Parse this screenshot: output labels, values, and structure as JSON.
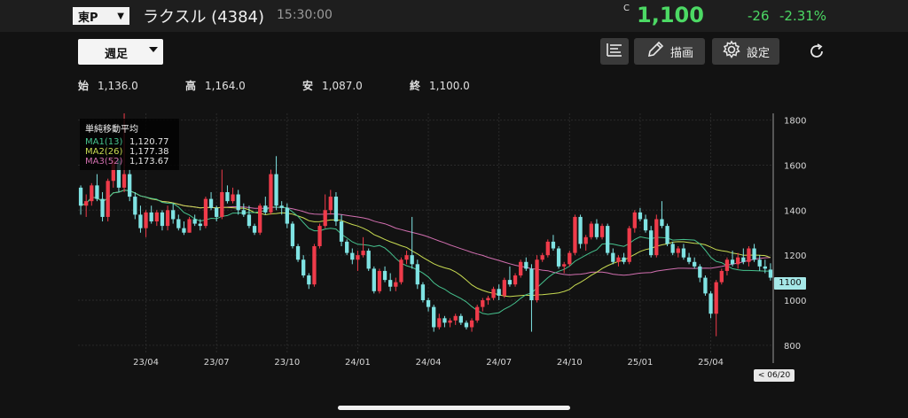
{
  "header": {
    "market": "東P",
    "name": "ラクスル (4384)",
    "time": "15:30:00",
    "price_flag": "C",
    "price": "1,100",
    "change": "-26",
    "change_pct": "-2.31%"
  },
  "toolbar": {
    "period": "週足",
    "draw_label": "描画",
    "settings_label": "設定",
    "list_icon": "list-icon",
    "pencil_icon": "pencil-icon",
    "gear_icon": "gear-icon",
    "refresh_icon": "refresh-icon"
  },
  "ohlc": {
    "open_label": "始",
    "open": "1,136.0",
    "high_label": "高",
    "high": "1,164.0",
    "low_label": "安",
    "low": "1,087.0",
    "close_label": "終",
    "close": "1,100.0"
  },
  "legend": {
    "title": "単純移動平均",
    "ma1_label": "MA1(13)",
    "ma1_value": "1,120.77",
    "ma2_label": "MA2(26)",
    "ma2_value": "1,177.38",
    "ma3_label": "MA3(52)",
    "ma3_value": "1,173.67"
  },
  "tags": {
    "price": "1100",
    "date": "< 06/20 >"
  },
  "colors": {
    "up": "#ef3b4a",
    "down": "#7fe3e3",
    "ma1": "#46c28e",
    "ma2": "#c9dc52",
    "ma3": "#d26fb0",
    "accent_green": "#4cd964"
  },
  "chart_data": {
    "type": "candlestick",
    "ylim": [
      760,
      1830
    ],
    "y_ticks": [
      800,
      1000,
      1200,
      1400,
      1600,
      1800
    ],
    "x_tick_labels": [
      "23/04",
      "23/07",
      "23/10",
      "24/01",
      "24/04",
      "24/07",
      "24/10",
      "25/01",
      "25/04"
    ],
    "x_tick_index": [
      12,
      25,
      38,
      51,
      64,
      77,
      90,
      103,
      116
    ],
    "ohlc": [
      [
        1500,
        1510,
        1380,
        1420
      ],
      [
        1420,
        1470,
        1370,
        1440
      ],
      [
        1440,
        1520,
        1420,
        1510
      ],
      [
        1510,
        1560,
        1440,
        1450
      ],
      [
        1450,
        1480,
        1350,
        1370
      ],
      [
        1370,
        1540,
        1350,
        1530
      ],
      [
        1530,
        1640,
        1500,
        1620
      ],
      [
        1620,
        1630,
        1480,
        1500
      ],
      [
        1500,
        1840,
        1480,
        1560
      ],
      [
        1560,
        1580,
        1440,
        1460
      ],
      [
        1460,
        1480,
        1360,
        1380
      ],
      [
        1380,
        1420,
        1300,
        1320
      ],
      [
        1320,
        1400,
        1280,
        1390
      ],
      [
        1390,
        1420,
        1340,
        1350
      ],
      [
        1350,
        1400,
        1330,
        1390
      ],
      [
        1390,
        1400,
        1310,
        1330
      ],
      [
        1330,
        1420,
        1310,
        1400
      ],
      [
        1400,
        1430,
        1340,
        1360
      ],
      [
        1360,
        1380,
        1310,
        1320
      ],
      [
        1320,
        1350,
        1290,
        1300
      ],
      [
        1300,
        1370,
        1300,
        1360
      ],
      [
        1360,
        1380,
        1330,
        1340
      ],
      [
        1340,
        1360,
        1310,
        1330
      ],
      [
        1330,
        1460,
        1320,
        1450
      ],
      [
        1450,
        1480,
        1400,
        1410
      ],
      [
        1410,
        1420,
        1350,
        1370
      ],
      [
        1370,
        1580,
        1360,
        1480
      ],
      [
        1480,
        1510,
        1430,
        1440
      ],
      [
        1440,
        1500,
        1430,
        1470
      ],
      [
        1470,
        1490,
        1380,
        1400
      ],
      [
        1400,
        1430,
        1370,
        1380
      ],
      [
        1380,
        1420,
        1320,
        1330
      ],
      [
        1330,
        1340,
        1290,
        1300
      ],
      [
        1300,
        1430,
        1290,
        1420
      ],
      [
        1420,
        1460,
        1380,
        1390
      ],
      [
        1390,
        1580,
        1380,
        1560
      ],
      [
        1560,
        1640,
        1400,
        1420
      ],
      [
        1420,
        1440,
        1380,
        1410
      ],
      [
        1410,
        1430,
        1320,
        1340
      ],
      [
        1340,
        1350,
        1230,
        1240
      ],
      [
        1240,
        1250,
        1170,
        1180
      ],
      [
        1180,
        1200,
        1100,
        1110
      ],
      [
        1110,
        1120,
        1050,
        1070
      ],
      [
        1070,
        1250,
        1060,
        1240
      ],
      [
        1240,
        1340,
        1230,
        1330
      ],
      [
        1330,
        1470,
        1320,
        1400
      ],
      [
        1400,
        1490,
        1380,
        1460
      ],
      [
        1460,
        1480,
        1330,
        1350
      ],
      [
        1350,
        1380,
        1240,
        1260
      ],
      [
        1260,
        1270,
        1200,
        1210
      ],
      [
        1210,
        1230,
        1160,
        1180
      ],
      [
        1180,
        1220,
        1130,
        1200
      ],
      [
        1200,
        1280,
        1190,
        1220
      ],
      [
        1220,
        1230,
        1130,
        1140
      ],
      [
        1140,
        1150,
        1030,
        1040
      ],
      [
        1040,
        1140,
        1030,
        1130
      ],
      [
        1130,
        1150,
        1080,
        1090
      ],
      [
        1090,
        1120,
        1040,
        1060
      ],
      [
        1060,
        1100,
        1040,
        1080
      ],
      [
        1080,
        1190,
        1070,
        1180
      ],
      [
        1180,
        1220,
        1160,
        1200
      ],
      [
        1200,
        1370,
        1140,
        1160
      ],
      [
        1160,
        1180,
        1050,
        1070
      ],
      [
        1070,
        1080,
        990,
        1000
      ],
      [
        1000,
        1010,
        950,
        970
      ],
      [
        970,
        980,
        860,
        880
      ],
      [
        880,
        940,
        870,
        920
      ],
      [
        920,
        930,
        880,
        900
      ],
      [
        900,
        920,
        880,
        910
      ],
      [
        910,
        940,
        890,
        930
      ],
      [
        930,
        940,
        890,
        900
      ],
      [
        900,
        910,
        870,
        880
      ],
      [
        880,
        920,
        860,
        910
      ],
      [
        910,
        980,
        900,
        970
      ],
      [
        970,
        1010,
        950,
        1000
      ],
      [
        1000,
        1020,
        980,
        1010
      ],
      [
        1010,
        1060,
        1000,
        1050
      ],
      [
        1050,
        1070,
        1000,
        1020
      ],
      [
        1020,
        1100,
        1010,
        1090
      ],
      [
        1090,
        1150,
        1060,
        1070
      ],
      [
        1070,
        1120,
        1060,
        1110
      ],
      [
        1110,
        1180,
        1100,
        1170
      ],
      [
        1170,
        1190,
        1130,
        1140
      ],
      [
        1140,
        1160,
        860,
        1000
      ],
      [
        1000,
        1200,
        990,
        1180
      ],
      [
        1180,
        1210,
        1170,
        1200
      ],
      [
        1200,
        1270,
        1190,
        1260
      ],
      [
        1260,
        1290,
        1220,
        1230
      ],
      [
        1230,
        1240,
        1140,
        1150
      ],
      [
        1150,
        1170,
        1120,
        1160
      ],
      [
        1160,
        1220,
        1150,
        1210
      ],
      [
        1210,
        1380,
        1200,
        1370
      ],
      [
        1370,
        1380,
        1230,
        1250
      ],
      [
        1250,
        1290,
        1220,
        1280
      ],
      [
        1280,
        1350,
        1270,
        1340
      ],
      [
        1340,
        1360,
        1270,
        1280
      ],
      [
        1280,
        1340,
        1270,
        1330
      ],
      [
        1330,
        1340,
        1200,
        1210
      ],
      [
        1210,
        1230,
        1160,
        1170
      ],
      [
        1170,
        1200,
        1150,
        1190
      ],
      [
        1190,
        1210,
        1160,
        1170
      ],
      [
        1170,
        1330,
        1160,
        1320
      ],
      [
        1320,
        1400,
        1300,
        1390
      ],
      [
        1390,
        1410,
        1350,
        1360
      ],
      [
        1360,
        1380,
        1300,
        1310
      ],
      [
        1310,
        1330,
        1190,
        1200
      ],
      [
        1200,
        1380,
        1190,
        1360
      ],
      [
        1360,
        1440,
        1320,
        1330
      ],
      [
        1330,
        1340,
        1240,
        1250
      ],
      [
        1250,
        1260,
        1200,
        1210
      ],
      [
        1210,
        1240,
        1190,
        1230
      ],
      [
        1230,
        1250,
        1180,
        1190
      ],
      [
        1190,
        1210,
        1160,
        1170
      ],
      [
        1170,
        1190,
        1140,
        1150
      ],
      [
        1150,
        1160,
        1080,
        1100
      ],
      [
        1100,
        1110,
        1020,
        1030
      ],
      [
        1030,
        1040,
        920,
        940
      ],
      [
        940,
        1090,
        840,
        1080
      ],
      [
        1080,
        1140,
        1070,
        1130
      ],
      [
        1130,
        1190,
        1110,
        1180
      ],
      [
        1180,
        1220,
        1150,
        1160
      ],
      [
        1160,
        1210,
        1140,
        1190
      ],
      [
        1190,
        1230,
        1160,
        1170
      ],
      [
        1170,
        1240,
        1150,
        1230
      ],
      [
        1230,
        1250,
        1170,
        1180
      ],
      [
        1180,
        1200,
        1130,
        1150
      ],
      [
        1150,
        1180,
        1120,
        1140
      ],
      [
        1136,
        1164,
        1087,
        1100
      ]
    ]
  }
}
